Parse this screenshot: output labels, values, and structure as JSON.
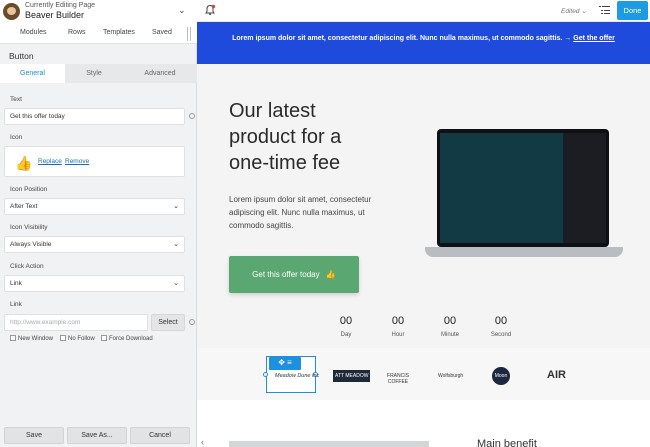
{
  "panel": {
    "editing_label": "Currently Editing Page",
    "app_name": "Beaver Builder",
    "nav": [
      "Modules",
      "Rows",
      "Templates",
      "Saved"
    ],
    "module_title": "Button",
    "tabs": [
      "General",
      "Style",
      "Advanced"
    ],
    "fields": {
      "text_label": "Text",
      "text_value": "Get this offer today",
      "icon_label": "Icon",
      "replace": "Replace",
      "remove": "Remove",
      "icon_position_label": "Icon Position",
      "icon_position_value": "After Text",
      "icon_visibility_label": "Icon Visibility",
      "icon_visibility_value": "Always Visible",
      "click_action_label": "Click Action",
      "click_action_value": "Link",
      "link_label": "Link",
      "link_placeholder": "http://www.example.com",
      "select": "Select",
      "new_window": "New Window",
      "no_follow": "No Follow",
      "force_download": "Force Download"
    },
    "footer": [
      "Save",
      "Save As...",
      "Cancel"
    ]
  },
  "topbar": {
    "edited": "Edited",
    "done": "Done"
  },
  "canvas": {
    "banner_text": "Lorem ipsum dolor sit amet, consectetur adipiscing elit. Nunc nulla maximus, ut commodo sagittis. →",
    "banner_link": "Get the offer",
    "hero_title": "Our latest product for a one-time fee",
    "hero_text": "Lorem ipsum dolor sit amet, consectetur adipiscing elit. Nunc nulla maximus, ut commodo sagittis.",
    "cta": "Get this offer today",
    "countdown": [
      {
        "value": "00",
        "label": "Day"
      },
      {
        "value": "00",
        "label": "Hour"
      },
      {
        "value": "00",
        "label": "Minute"
      },
      {
        "value": "00",
        "label": "Second"
      }
    ],
    "logos": [
      "Meadow Dune Inc",
      "ATT MEADOW",
      "FRANCIS COFFEE",
      "Wolfsburgh",
      "Moon",
      "AIR"
    ],
    "peek_text": "Main benefit"
  },
  "colors": {
    "accent": "#1e9be0",
    "banner": "#1e4bdc",
    "cta": "#5aa772"
  }
}
